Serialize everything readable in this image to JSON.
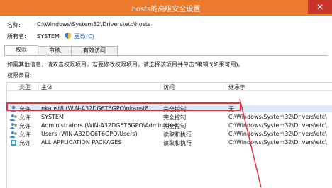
{
  "window": {
    "title": "hosts的高级安全设置"
  },
  "name_label": "名称:",
  "name_value": "C:\\Windows\\System32\\Drivers\\etc\\hosts",
  "owner_label": "所有者:",
  "owner_value": "SYSTEM",
  "owner_change_link": "更改(C)",
  "tabs": [
    {
      "label": "权限"
    },
    {
      "label": "审核"
    },
    {
      "label": "有效访问"
    }
  ],
  "hint_text": "如需其他信息，请双击权限项目。若要修改权限项目，请选择该项目并单击\"编辑\"(如果可用)。",
  "entries_label": "权限条目:",
  "columns": [
    "类型",
    "主体",
    "访问",
    "继承于"
  ],
  "rows": [
    {
      "type": "允许",
      "principal": "pkaust8 (WIN-A32DG6T6GPO\\pkaust8)",
      "access": "完全控制",
      "inherited": "无"
    },
    {
      "type": "允许",
      "principal": "SYSTEM",
      "access": "完全控制",
      "inherited": "C:\\Windows\\System32\\Drivers\\etc\\"
    },
    {
      "type": "允许",
      "principal": "Administrators (WIN-A32DG6T6GPO\\Administrat...",
      "access": "完全控制",
      "inherited": "C:\\Windows\\System32\\Drivers\\etc\\"
    },
    {
      "type": "允许",
      "principal": "Users (WIN-A32DG6T6GPO\\Users)",
      "access": "读取和执行",
      "inherited": "C:\\Windows\\System32\\Drivers\\etc\\"
    },
    {
      "type": "允许",
      "principal": "ALL APPLICATION PACKAGES",
      "access": "读取和执行",
      "inherited": "C:\\Windows\\System32\\Drivers\\etc\\"
    }
  ],
  "colors": {
    "titlebar": "#ec7a2c",
    "highlight": "#e0343a",
    "link": "#1e5fc8"
  }
}
